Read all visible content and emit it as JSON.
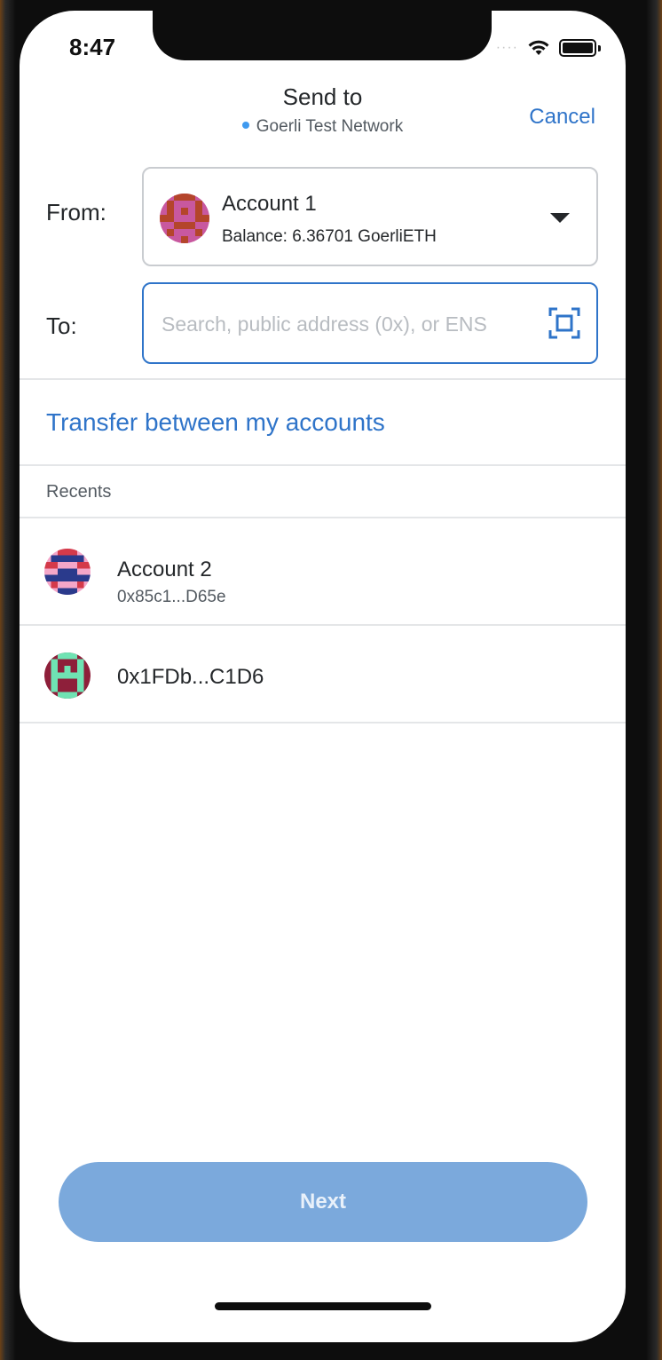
{
  "status_bar": {
    "time": "8:47"
  },
  "header": {
    "title": "Send to",
    "network": "Goerli Test Network",
    "cancel_label": "Cancel"
  },
  "from": {
    "label": "From:",
    "account_name": "Account 1",
    "balance": "Balance: 6.36701 GoerliETH"
  },
  "to": {
    "label": "To:",
    "placeholder": "Search, public address (0x), or ENS"
  },
  "transfer_link": "Transfer between my accounts",
  "recents": {
    "label": "Recents",
    "items": [
      {
        "name": "Account 2",
        "address": "0x85c1...D65e"
      },
      {
        "name": "0x1FDb...C1D6"
      }
    ]
  },
  "footer": {
    "next_label": "Next"
  },
  "colors": {
    "accent": "#2f74c9",
    "next_disabled": "#7ba9dc",
    "network_dot": "#3f9aef"
  }
}
